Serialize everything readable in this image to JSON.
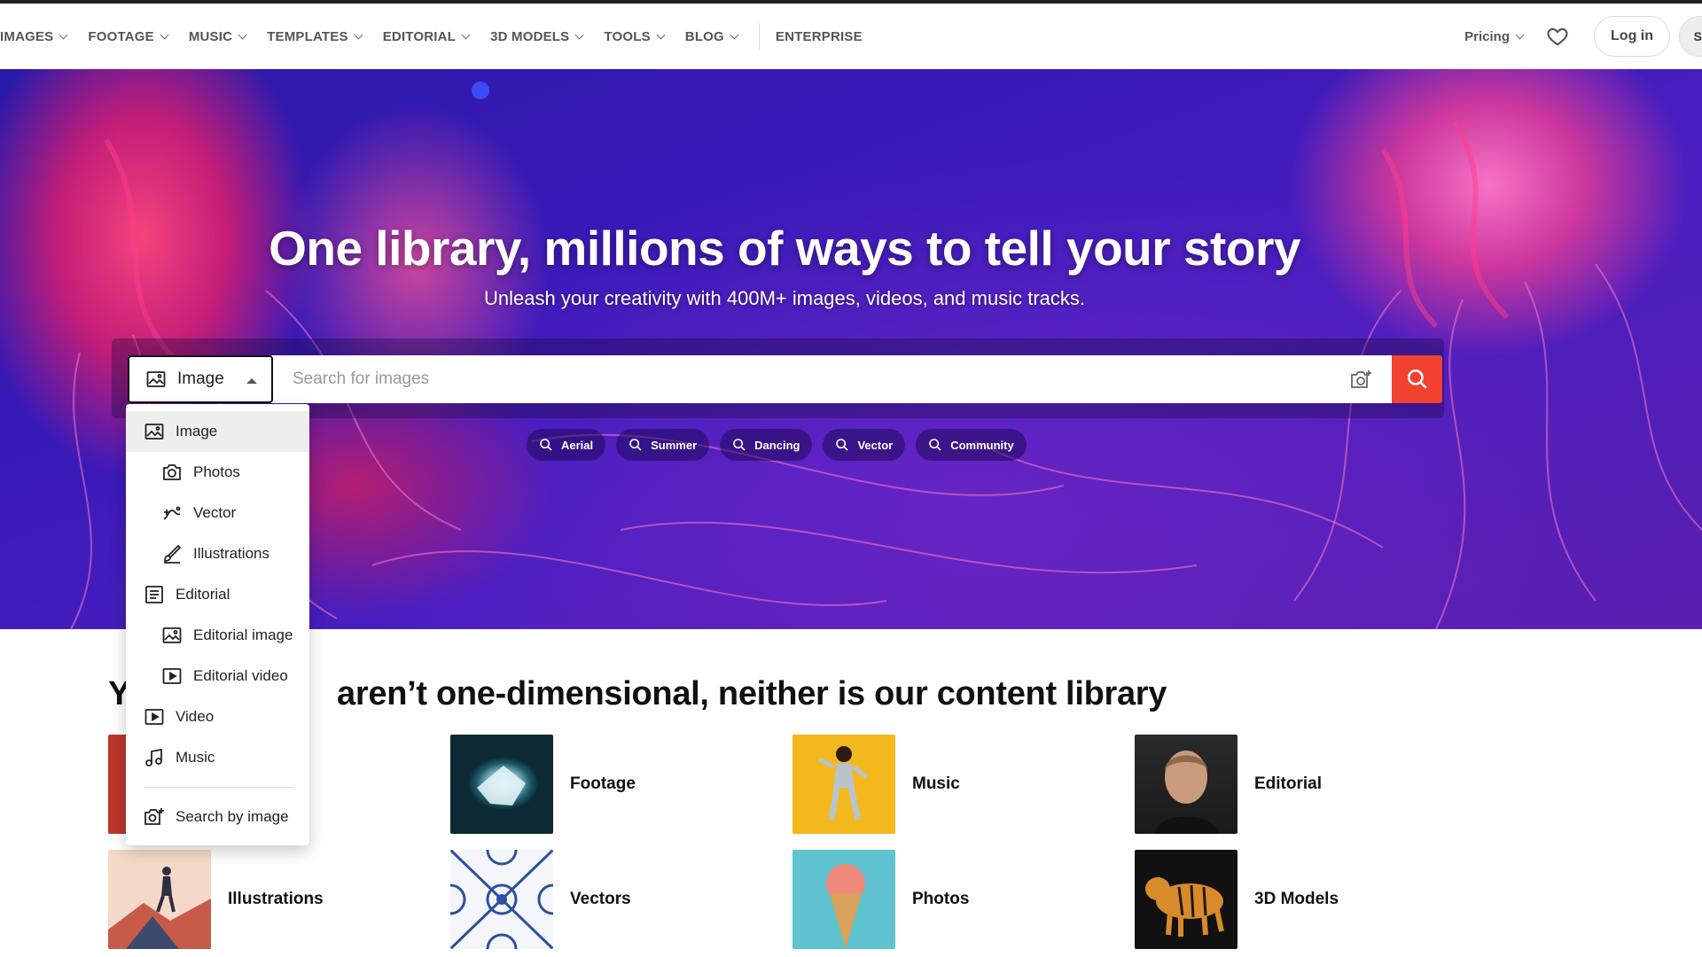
{
  "nav": {
    "items": [
      {
        "label": "IMAGES"
      },
      {
        "label": "FOOTAGE"
      },
      {
        "label": "MUSIC"
      },
      {
        "label": "TEMPLATES"
      },
      {
        "label": "EDITORIAL"
      },
      {
        "label": "3D MODELS"
      },
      {
        "label": "TOOLS"
      },
      {
        "label": "BLOG"
      }
    ],
    "enterprise": "ENTERPRISE",
    "pricing": "Pricing",
    "login": "Log in",
    "signup_stub": "S"
  },
  "hero": {
    "title": "One library, millions of ways to tell your story",
    "subtitle": "Unleash your creativity with 400M+ images, videos, and music tracks."
  },
  "search": {
    "type_selected": "Image",
    "placeholder": "Search for images",
    "accent": "#f2412e"
  },
  "chips": [
    {
      "label": "Aerial"
    },
    {
      "label": "Summer"
    },
    {
      "label": "Dancing"
    },
    {
      "label": "Vector"
    },
    {
      "label": "Community"
    }
  ],
  "dropdown": {
    "items": [
      {
        "label": "Image",
        "icon": "image-icon"
      },
      {
        "label": "Photos",
        "icon": "camera-icon"
      },
      {
        "label": "Vector",
        "icon": "vector-pen-icon"
      },
      {
        "label": "Illustrations",
        "icon": "brush-icon"
      },
      {
        "label": "Editorial",
        "icon": "editorial-icon"
      },
      {
        "label": "Editorial image",
        "icon": "image-icon"
      },
      {
        "label": "Editorial video",
        "icon": "video-icon"
      },
      {
        "label": "Video",
        "icon": "video-icon"
      },
      {
        "label": "Music",
        "icon": "music-note-icon"
      }
    ],
    "search_by_image": "Search by image"
  },
  "section": {
    "title_left": "Y",
    "title_right": "aren’t one-dimensional, neither is our content library",
    "categories": [
      {
        "label": "Footage"
      },
      {
        "label": "Music"
      },
      {
        "label": "Editorial"
      },
      {
        "label": "Illustrations"
      },
      {
        "label": "Vectors"
      },
      {
        "label": "Photos"
      },
      {
        "label": "3D Models"
      }
    ]
  }
}
